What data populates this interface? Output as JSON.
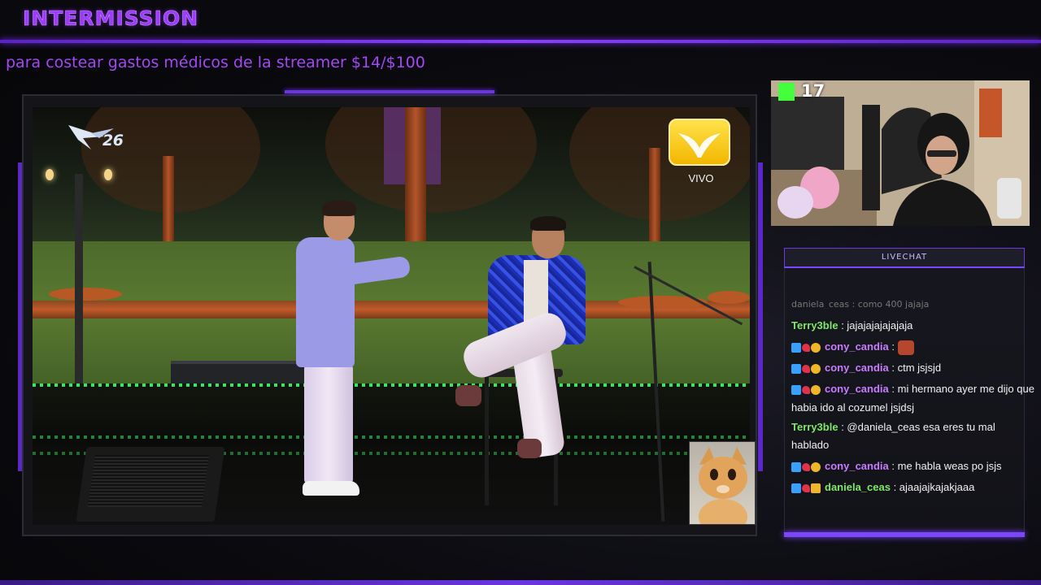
{
  "header": {
    "brand": "INTERMISSION",
    "ticker": "para costear gastos médicos de la streamer $14/$100"
  },
  "broadcast": {
    "channel_number": "26",
    "live_label": "VIVO"
  },
  "webcam": {
    "viewer_count": "17",
    "platform_icon": "kick-icon"
  },
  "chat": {
    "title": "LIVECHAT",
    "partial_top": "daniela_ceas : como 400 jajaja",
    "messages": [
      {
        "user": "Terry3ble",
        "sep": " : ",
        "text": "jajajajajajajaja",
        "badges": []
      },
      {
        "user": "cony_candia",
        "sep": " : ",
        "text": "",
        "badges": [
          "prime",
          "heart",
          "coin"
        ],
        "emote": "emote-face"
      },
      {
        "user": "cony_candia",
        "sep": " : ",
        "text": "ctm jsjsjd",
        "badges": [
          "prime",
          "heart",
          "coin"
        ]
      },
      {
        "user": "cony_candia",
        "sep": " : ",
        "text": "mi hermano ayer me dijo que habia ido al cozumel jsjdsj",
        "badges": [
          "prime",
          "heart",
          "coin"
        ]
      },
      {
        "user": "Terry3ble",
        "sep": " : ",
        "text": "@daniela_ceas esa eres tu mal hablado",
        "badges": []
      },
      {
        "user": "cony_candia",
        "sep": " : ",
        "text": "me habla weas po jsjs",
        "badges": [
          "prime",
          "heart",
          "coin"
        ]
      },
      {
        "user": "daniela_ceas",
        "sep": " : ",
        "text": "ajaajajkajakjaaa",
        "badges": [
          "prime",
          "heart",
          "crown"
        ]
      }
    ]
  },
  "colors": {
    "accent": "#7d45ff",
    "brand": "#9b3cff",
    "ticker": "#a248f5",
    "kick_green": "#43ff3c",
    "username_green": "#7fe86a",
    "username_purple": "#c77cff"
  }
}
